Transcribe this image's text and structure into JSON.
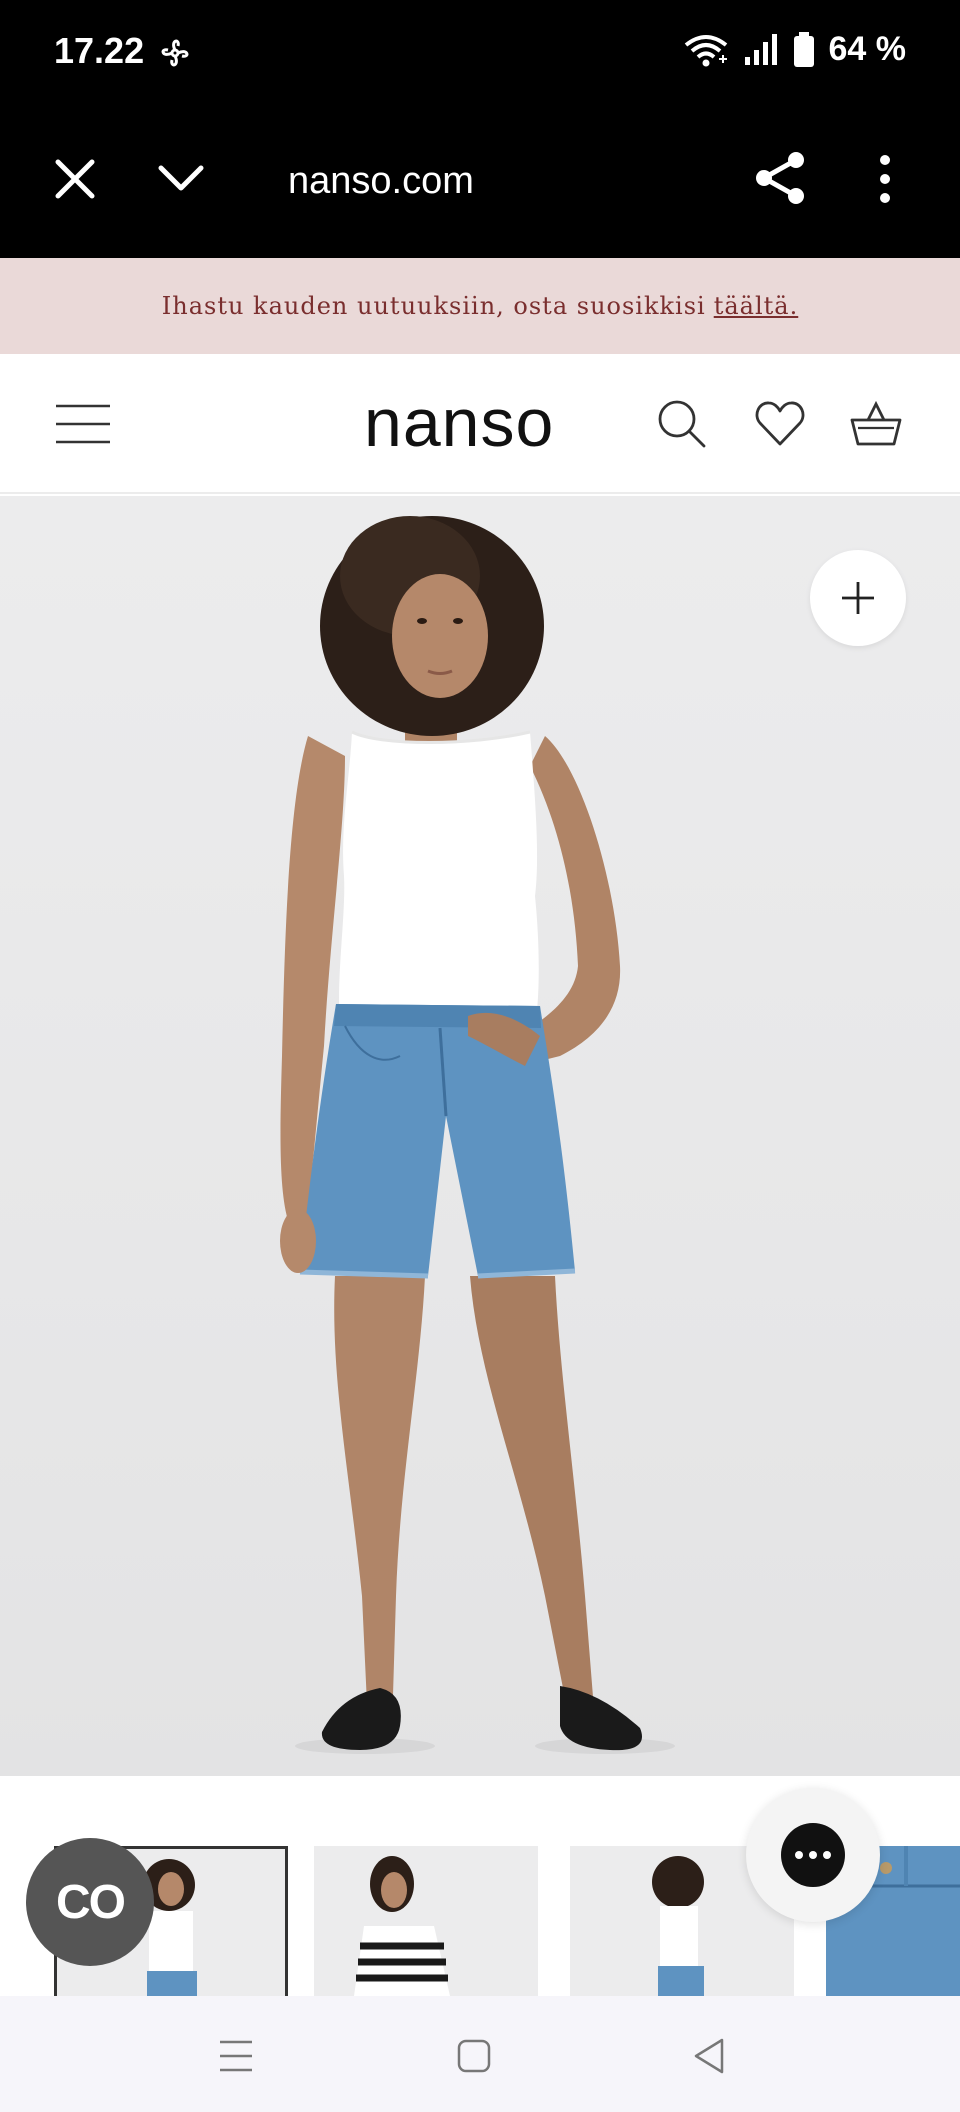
{
  "status_bar": {
    "time": "17.22",
    "battery": "64 %"
  },
  "browser": {
    "url": "nanso.com"
  },
  "promo": {
    "text": "Ihastu kauden uutuuksiin, osta suosikkisi",
    "link": "täältä."
  },
  "header": {
    "logo": "nanso"
  },
  "cobrowse": {
    "label": "CO"
  },
  "colors": {
    "promo_bg": "#ead9d8",
    "promo_text": "#7a2e2e",
    "shorts_denim": "#5e93c1"
  }
}
